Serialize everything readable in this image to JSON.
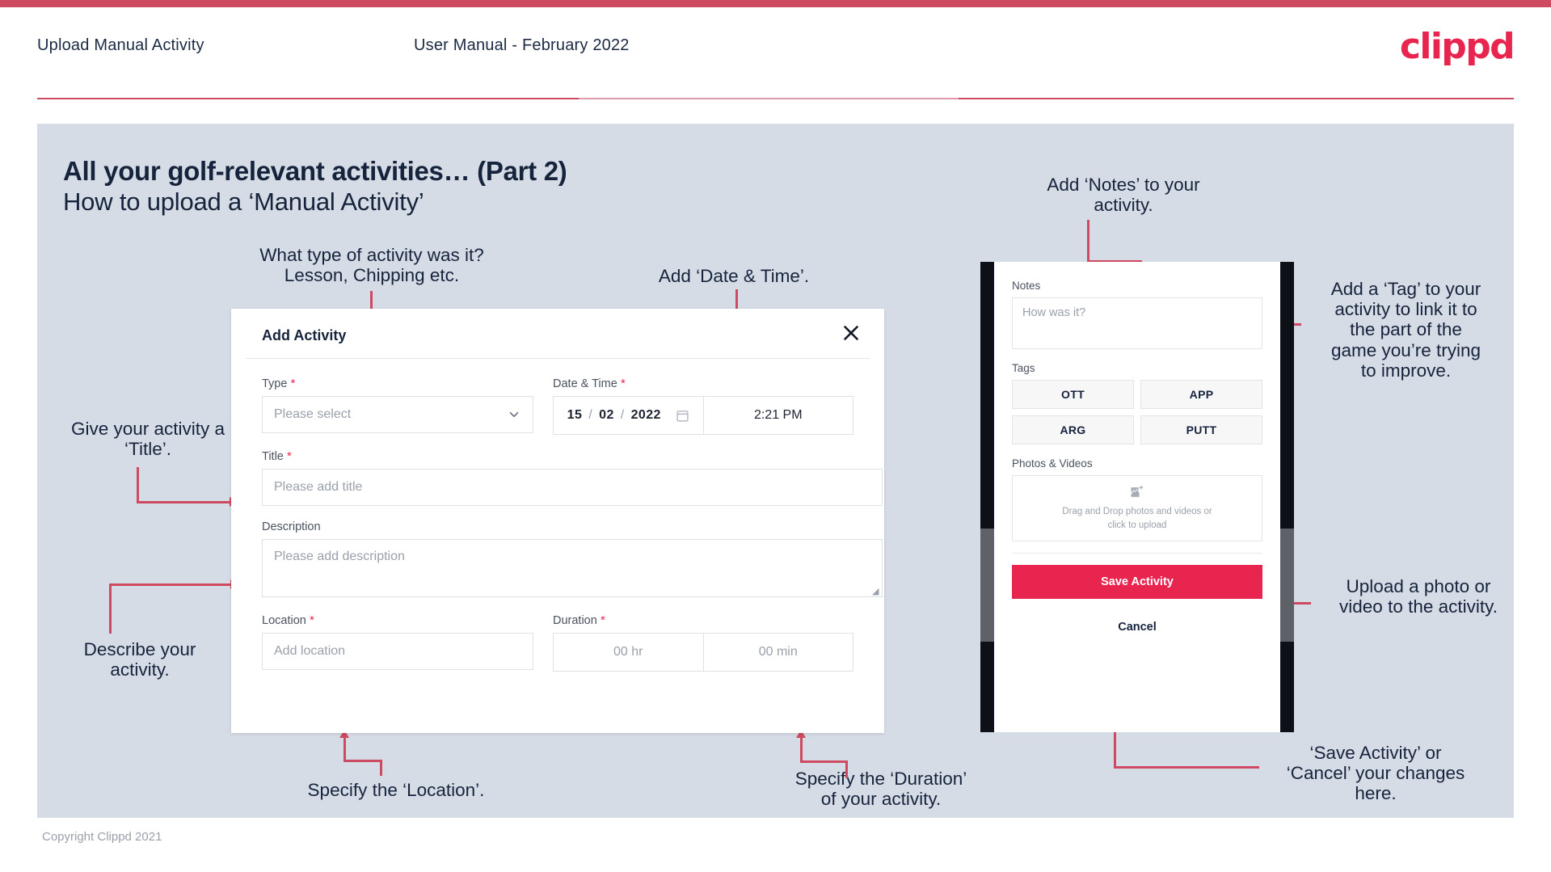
{
  "header": {
    "title": "Upload Manual Activity",
    "subtitle": "User Manual - February 2022",
    "logo": "clippd"
  },
  "slide": {
    "title": "All your golf-relevant activities… (Part 2)",
    "subtitle": "How to upload a ‘Manual Activity’"
  },
  "annotations": {
    "type": "What type of activity was it?\nLesson, Chipping etc.",
    "date_time": "Add ‘Date & Time’.",
    "notes": "Add ‘Notes’ to your\nactivity.",
    "tag": "Add a ‘Tag’ to your\nactivity to link it to\nthe part of the\ngame you’re trying\nto improve.",
    "title_field": "Give your activity a\n‘Title’.",
    "description": "Describe your\nactivity.",
    "location": "Specify the ‘Location’.",
    "duration": "Specify the ‘Duration’\nof your activity.",
    "upload": "Upload a photo or\nvideo to the activity.",
    "save_cancel": "‘Save Activity’ or\n‘Cancel’ your changes\nhere."
  },
  "modal": {
    "title": "Add Activity",
    "close_icon": "close-icon",
    "fields": {
      "type": {
        "label": "Type",
        "required": true,
        "placeholder": "Please select",
        "value": "",
        "icon": "chevron-down-icon"
      },
      "date_time": {
        "label": "Date & Time",
        "required": true,
        "day": "15",
        "month": "02",
        "year": "2022",
        "separator": "/",
        "calendar_icon": "calendar-icon",
        "time": "2:21 PM"
      },
      "title": {
        "label": "Title",
        "required": true,
        "placeholder": "Please add title",
        "value": ""
      },
      "description": {
        "label": "Description",
        "required": false,
        "placeholder": "Please add description",
        "value": ""
      },
      "location": {
        "label": "Location",
        "required": true,
        "placeholder": "Add location",
        "value": ""
      },
      "duration": {
        "label": "Duration",
        "required": true,
        "hours_placeholder": "00 hr",
        "minutes_placeholder": "00 min"
      }
    }
  },
  "phone": {
    "notes": {
      "label": "Notes",
      "placeholder": "How was it?",
      "value": ""
    },
    "tags": {
      "label": "Tags",
      "items": [
        "OTT",
        "APP",
        "ARG",
        "PUTT"
      ]
    },
    "photos": {
      "label": "Photos & Videos",
      "icon": "add-image-icon",
      "drop_line1": "Drag and Drop photos and videos or",
      "drop_line2": "click to upload"
    },
    "save_label": "Save Activity",
    "cancel_label": "Cancel"
  },
  "footer": {
    "copyright": "Copyright Clippd 2021"
  },
  "colors": {
    "brand_pink": "#e8254f",
    "rule_crimson": "#cd4a60",
    "slide_bg": "#d6dce5",
    "text_navy": "#16233c"
  }
}
